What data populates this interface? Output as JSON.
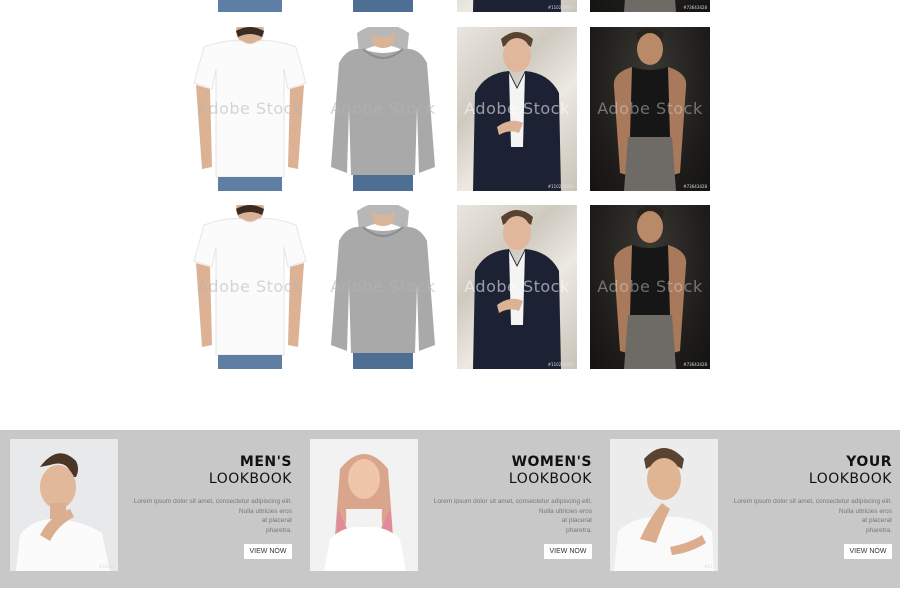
{
  "products": {
    "watermark": "Adobe Stock",
    "rows": [
      [
        {
          "kind": "tshirt",
          "id": ""
        },
        {
          "kind": "hoodie",
          "id": ""
        },
        {
          "kind": "suit",
          "id": "#110228800"
        },
        {
          "kind": "tank",
          "id": "#73643428"
        }
      ],
      [
        {
          "kind": "tshirt",
          "id": ""
        },
        {
          "kind": "hoodie",
          "id": ""
        },
        {
          "kind": "suit",
          "id": "#110228800"
        },
        {
          "kind": "tank",
          "id": "#73643428"
        }
      ],
      [
        {
          "kind": "tshirt",
          "id": ""
        },
        {
          "kind": "hoodie",
          "id": ""
        },
        {
          "kind": "suit",
          "id": "#110228800"
        },
        {
          "kind": "tank",
          "id": "#73643428"
        }
      ]
    ]
  },
  "lookbooks": [
    {
      "line1": "MEN'S",
      "line2": "LOOKBOOK",
      "text": [
        "Lorem ipsum dolor sit amet, consectetur adipiscing elit.",
        "Nulla ultricies eros",
        "at placerat",
        "pharetra."
      ],
      "button": "VIEW NOW",
      "photo": "man-white-tee",
      "id": "#23161"
    },
    {
      "line1": "WOMEN'S",
      "line2": "LOOKBOOK",
      "text": [
        "Lorem ipsum dolor sit amet, consectetur adipiscing elit.",
        "Nulla ultricies eros",
        "at placerat",
        "pharetra."
      ],
      "button": "VIEW NOW",
      "photo": "woman-pink-hair",
      "id": ""
    },
    {
      "line1": "YOUR",
      "line2": "LOOKBOOK",
      "text": [
        "Lorem ipsum dolor sit amet, consectetur adipiscing elit.",
        "Nulla ultricies eros",
        "at placerat",
        "pharetra."
      ],
      "button": "VIEW NOW",
      "photo": "man-thinking",
      "id": "#117"
    }
  ],
  "colors": {
    "band": "#c8c8c8",
    "title": "#111111",
    "body_text": "#777777"
  }
}
